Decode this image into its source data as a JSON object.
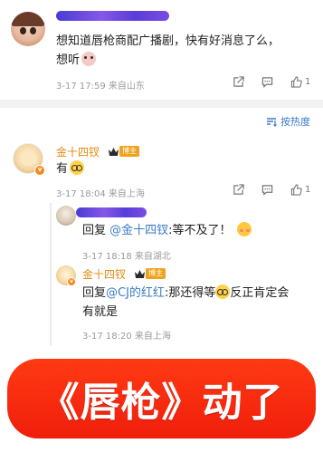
{
  "comment1": {
    "text_line1": "想知道唇枪商配广播剧，快有好消息了么，",
    "text_line2": "想听",
    "meta": "3-17 17:59  来自山东",
    "like_count": "1"
  },
  "sort": {
    "label": "按热度"
  },
  "comment2": {
    "username": "金十四钗",
    "badge": "博主",
    "text": "有",
    "meta": "3-17 18:04  来自上海",
    "like_count": "1"
  },
  "reply1": {
    "prefix": "回复",
    "mention": "@金十四钗",
    "text": ":等不及了！",
    "meta": "3-17 18:18  来自湖北"
  },
  "reply2": {
    "username": "金十四钗",
    "badge": "博主",
    "prefix": "回复",
    "mention": "@CJ的红红",
    "text_a": ":那还得等",
    "text_b": "反正肯定会",
    "text_line2": "有就是",
    "meta": "3-17 18:20  来自上海"
  },
  "banner": {
    "text": "《唇枪》动了"
  },
  "colors": {
    "accent_link": "#3b7ac7",
    "username": "#e28a12",
    "banner_bg": "#f01e0b"
  },
  "icons": [
    "share-icon",
    "comment-icon",
    "like-icon",
    "sort-icon",
    "crown-icon",
    "verified-icon"
  ]
}
